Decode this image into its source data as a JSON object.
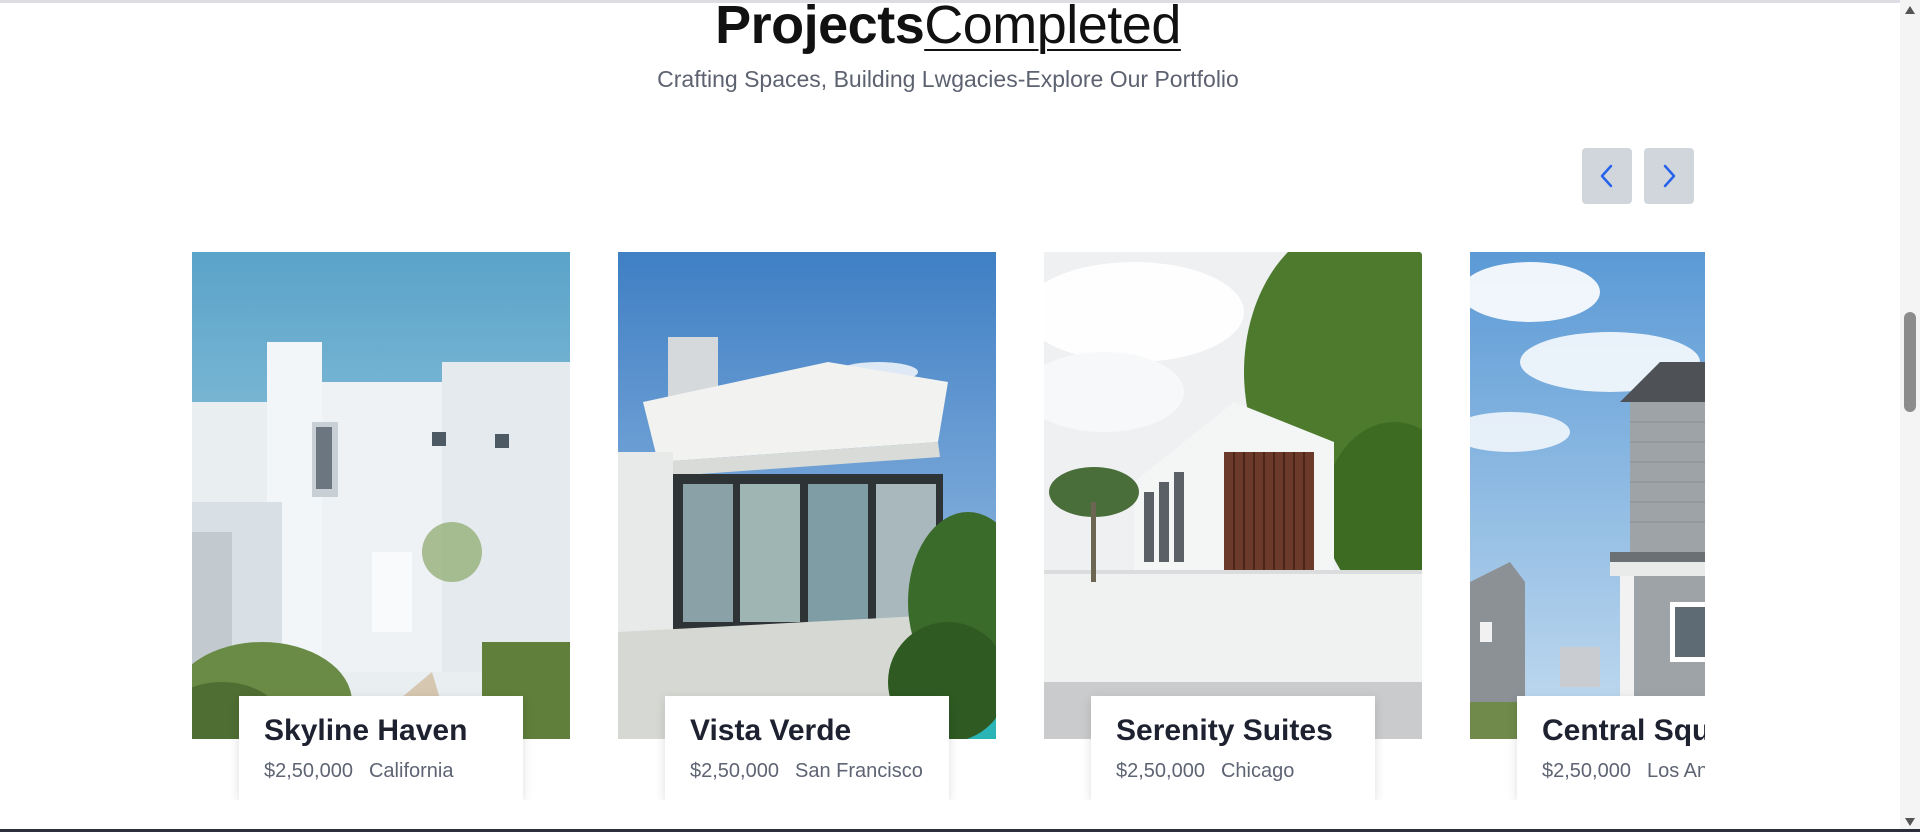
{
  "section": {
    "title_bold": "Projects",
    "title_light": "Completed",
    "subtitle": "Crafting Spaces, Building Lwgacies-Explore Our Portfolio"
  },
  "carousel": {
    "prev_icon": "chevron-left-icon",
    "next_icon": "chevron-right-icon",
    "accent_color": "#2563eb",
    "button_bg": "#d1d5dc"
  },
  "projects": [
    {
      "name": "Skyline Haven",
      "price": "$2,50,000",
      "location": "California"
    },
    {
      "name": "Vista Verde",
      "price": "$2,50,000",
      "location": "San Francisco"
    },
    {
      "name": "Serenity Suites",
      "price": "$2,50,000",
      "location": "Chicago"
    },
    {
      "name": "Central Square",
      "price": "$2,50,000",
      "location": "Los Angeles"
    }
  ]
}
